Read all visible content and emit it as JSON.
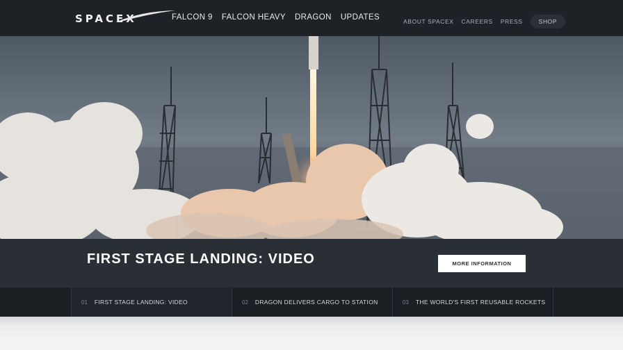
{
  "brand": {
    "logo_text": "SPACEX"
  },
  "nav": {
    "main": [
      "FALCON 9",
      "FALCON HEAVY",
      "DRAGON",
      "UPDATES"
    ],
    "secondary": [
      "ABOUT SPACEX",
      "CAREERS",
      "PRESS"
    ],
    "shop": "SHOP"
  },
  "hero": {
    "image": "rocket-launch-photo"
  },
  "caption": {
    "title": "FIRST STAGE LANDING: VIDEO",
    "button": "MORE INFORMATION"
  },
  "tabs": [
    {
      "num": "01",
      "label": "FIRST STAGE LANDING: VIDEO"
    },
    {
      "num": "02",
      "label": "DRAGON DELIVERS CARGO TO STATION"
    },
    {
      "num": "03",
      "label": "THE WORLD'S FIRST REUSABLE ROCKETS"
    }
  ],
  "colors": {
    "navbar": "#1e2227",
    "caption_bar": "#2a2f35",
    "tabs_bar": "#1b1f24",
    "button": "#ffffff"
  }
}
